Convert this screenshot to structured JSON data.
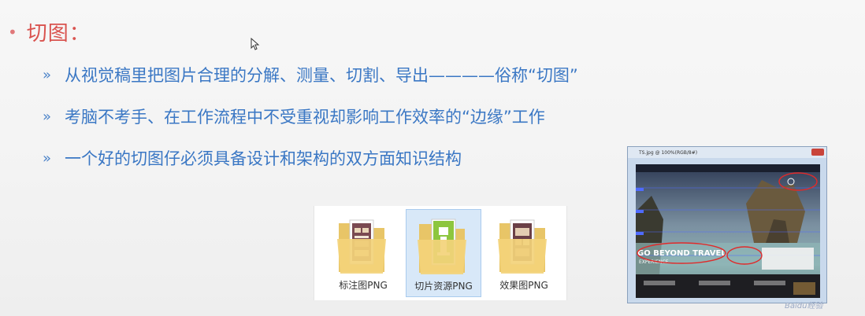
{
  "slide": {
    "heading": "切图：",
    "bullets": [
      "从视觉稿里把图片合理的分解、测量、切割、导出————俗称“切图”",
      "考脑不考手、在工作流程中不受重视却影响工作效率的“边缘”工作",
      "一个好的切图仔必须具备设计和架构的双方面知识结构"
    ],
    "bullet_marker": "»"
  },
  "folders": [
    {
      "label": "标注图PNG",
      "selected": false
    },
    {
      "label": "切片资源PNG",
      "selected": true
    },
    {
      "label": "效果图PNG",
      "selected": false
    }
  ],
  "ps_window": {
    "title": "TS.jpg @ 100%(RGB/8#)",
    "headline": "GO BEYOND TRAVEL",
    "subline": "EXPERIENCE"
  },
  "colors": {
    "heading": "#d9534f",
    "bullet_text": "#3a77c4",
    "folder_selected": "#d8e8f8",
    "annotation_red": "#e02a2a"
  },
  "watermark": "Baidu经验"
}
